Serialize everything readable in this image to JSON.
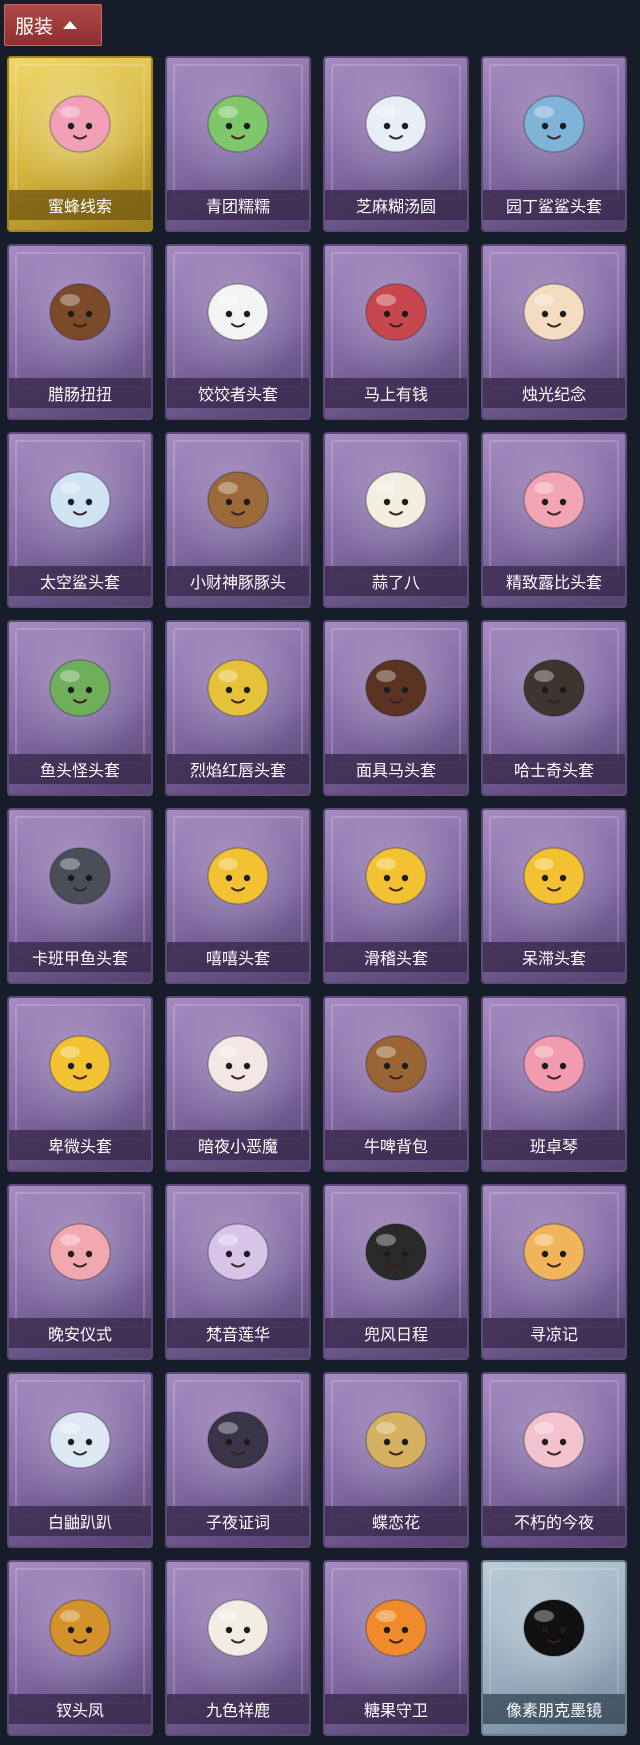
{
  "header": {
    "label": "服装"
  },
  "items": [
    {
      "label": "蜜蜂线索",
      "color": "#f2a0b8",
      "rarity": "gold"
    },
    {
      "label": "青团糯糯",
      "color": "#7fc76a",
      "rarity": "purple"
    },
    {
      "label": "芝麻糊汤圆",
      "color": "#e8eef5",
      "rarity": "purple"
    },
    {
      "label": "园丁鲨鲨头套",
      "color": "#7fb4d8",
      "rarity": "purple"
    },
    {
      "label": "腊肠扭扭",
      "color": "#7a4a2a",
      "rarity": "purple"
    },
    {
      "label": "饺饺者头套",
      "color": "#f3f3f3",
      "rarity": "purple"
    },
    {
      "label": "马上有钱",
      "color": "#c8474e",
      "rarity": "purple"
    },
    {
      "label": "烛光纪念",
      "color": "#f4dcc0",
      "rarity": "purple"
    },
    {
      "label": "太空鲨头套",
      "color": "#cfe3f2",
      "rarity": "purple"
    },
    {
      "label": "小财神豚豚头",
      "color": "#9a6a3a",
      "rarity": "purple"
    },
    {
      "label": "蒜了八",
      "color": "#f2eee0",
      "rarity": "purple"
    },
    {
      "label": "精致露比头套",
      "color": "#f1a4b4",
      "rarity": "purple"
    },
    {
      "label": "鱼头怪头套",
      "color": "#6fae5a",
      "rarity": "purple"
    },
    {
      "label": "烈焰红唇头套",
      "color": "#e6c23a",
      "rarity": "purple"
    },
    {
      "label": "面具马头套",
      "color": "#5a3322",
      "rarity": "purple"
    },
    {
      "label": "哈士奇头套",
      "color": "#3c3530",
      "rarity": "purple"
    },
    {
      "label": "卡班甲鱼头套",
      "color": "#4a4e58",
      "rarity": "purple"
    },
    {
      "label": "嘻嘻头套",
      "color": "#f2c232",
      "rarity": "purple"
    },
    {
      "label": "滑稽头套",
      "color": "#f2c232",
      "rarity": "purple"
    },
    {
      "label": "呆滞头套",
      "color": "#f2c232",
      "rarity": "purple"
    },
    {
      "label": "卑微头套",
      "color": "#f2c232",
      "rarity": "purple"
    },
    {
      "label": "暗夜小恶魔",
      "color": "#f3e6e4",
      "rarity": "purple"
    },
    {
      "label": "牛啤背包",
      "color": "#9a6434",
      "rarity": "purple"
    },
    {
      "label": "班卓琴",
      "color": "#f29ab0",
      "rarity": "purple"
    },
    {
      "label": "晚安仪式",
      "color": "#f2a8b0",
      "rarity": "purple"
    },
    {
      "label": "梵音莲华",
      "color": "#d8c4e8",
      "rarity": "purple"
    },
    {
      "label": "兜风日程",
      "color": "#2a2a2a",
      "rarity": "purple"
    },
    {
      "label": "寻凉记",
      "color": "#f0b45a",
      "rarity": "purple"
    },
    {
      "label": "白鼬趴趴",
      "color": "#dde8f4",
      "rarity": "purple"
    },
    {
      "label": "子夜证词",
      "color": "#3a3448",
      "rarity": "purple"
    },
    {
      "label": "蝶恋花",
      "color": "#d4b060",
      "rarity": "purple"
    },
    {
      "label": "不朽的今夜",
      "color": "#f2c2cf",
      "rarity": "purple"
    },
    {
      "label": "钗头凤",
      "color": "#d4922a",
      "rarity": "purple"
    },
    {
      "label": "九色祥鹿",
      "color": "#f2ede2",
      "rarity": "purple"
    },
    {
      "label": "糖果守卫",
      "color": "#f08a2a",
      "rarity": "purple"
    },
    {
      "label": "像素朋克墨镜",
      "color": "#111111",
      "rarity": "blue"
    }
  ]
}
